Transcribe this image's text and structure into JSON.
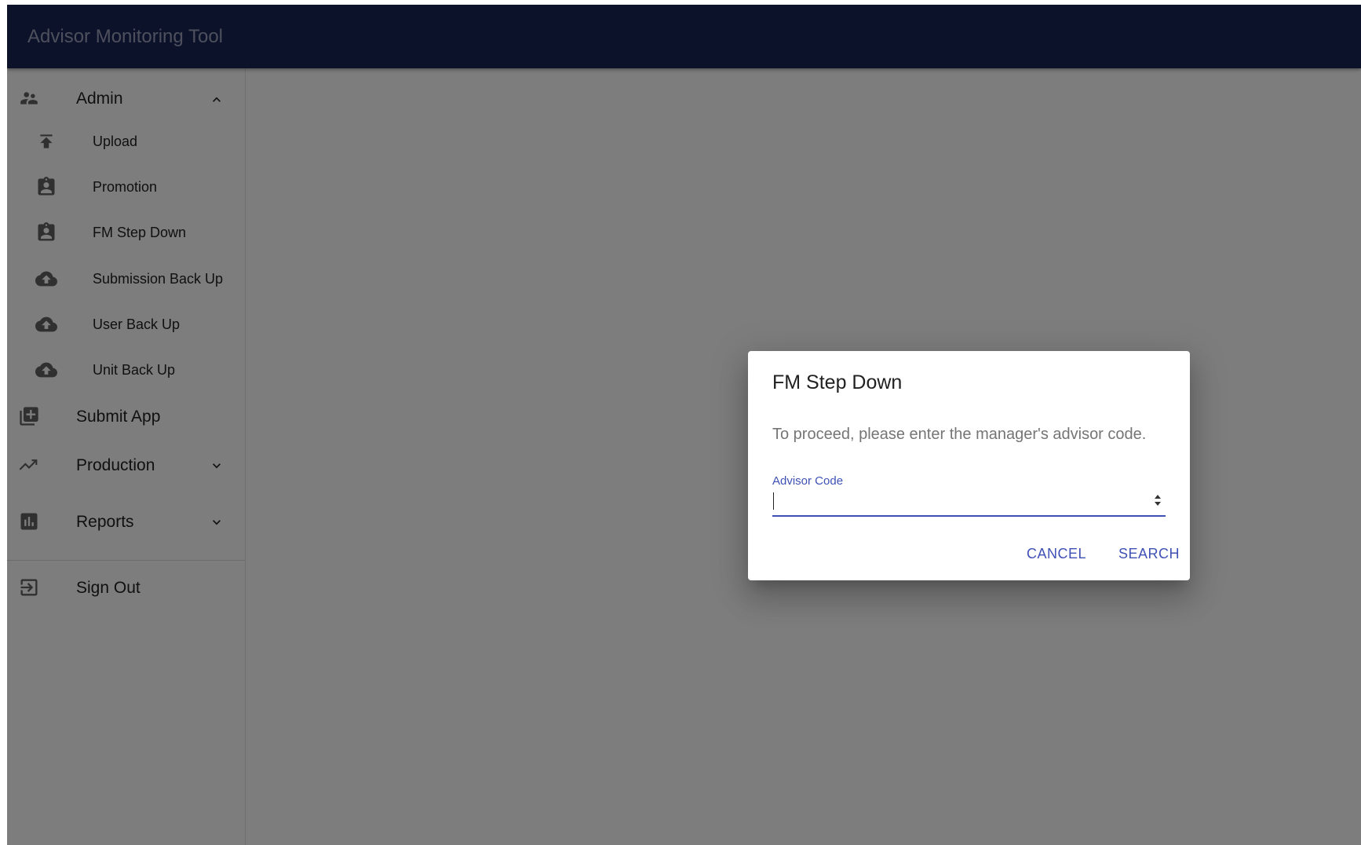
{
  "app": {
    "title": "Advisor Monitoring Tool"
  },
  "sidebar": {
    "admin": {
      "label": "Admin",
      "icon": "supervisor-account-icon",
      "expanded": true
    },
    "admin_items": [
      {
        "label": "Upload",
        "icon": "upload-icon"
      },
      {
        "label": "Promotion",
        "icon": "assignment-ind-icon"
      },
      {
        "label": "FM Step Down",
        "icon": "assignment-ind-icon"
      },
      {
        "label": "Submission Back Up",
        "icon": "cloud-upload-icon"
      },
      {
        "label": "User Back Up",
        "icon": "cloud-upload-icon"
      },
      {
        "label": "Unit Back Up",
        "icon": "cloud-upload-icon"
      }
    ],
    "submit_app": {
      "label": "Submit App",
      "icon": "library-add-icon"
    },
    "production": {
      "label": "Production",
      "icon": "trending-up-icon",
      "expanded": false
    },
    "reports": {
      "label": "Reports",
      "icon": "assessment-icon",
      "expanded": false
    },
    "sign_out": {
      "label": "Sign Out",
      "icon": "exit-to-app-icon"
    }
  },
  "dialog": {
    "title": "FM Step Down",
    "message": "To proceed, please enter the manager's advisor code.",
    "field_label": "Advisor Code",
    "field_value": "",
    "cancel_label": "Cancel",
    "search_label": "Search"
  },
  "colors": {
    "appbar": "#1b2457",
    "primary": "#3f51b5",
    "icon": "#616161"
  }
}
